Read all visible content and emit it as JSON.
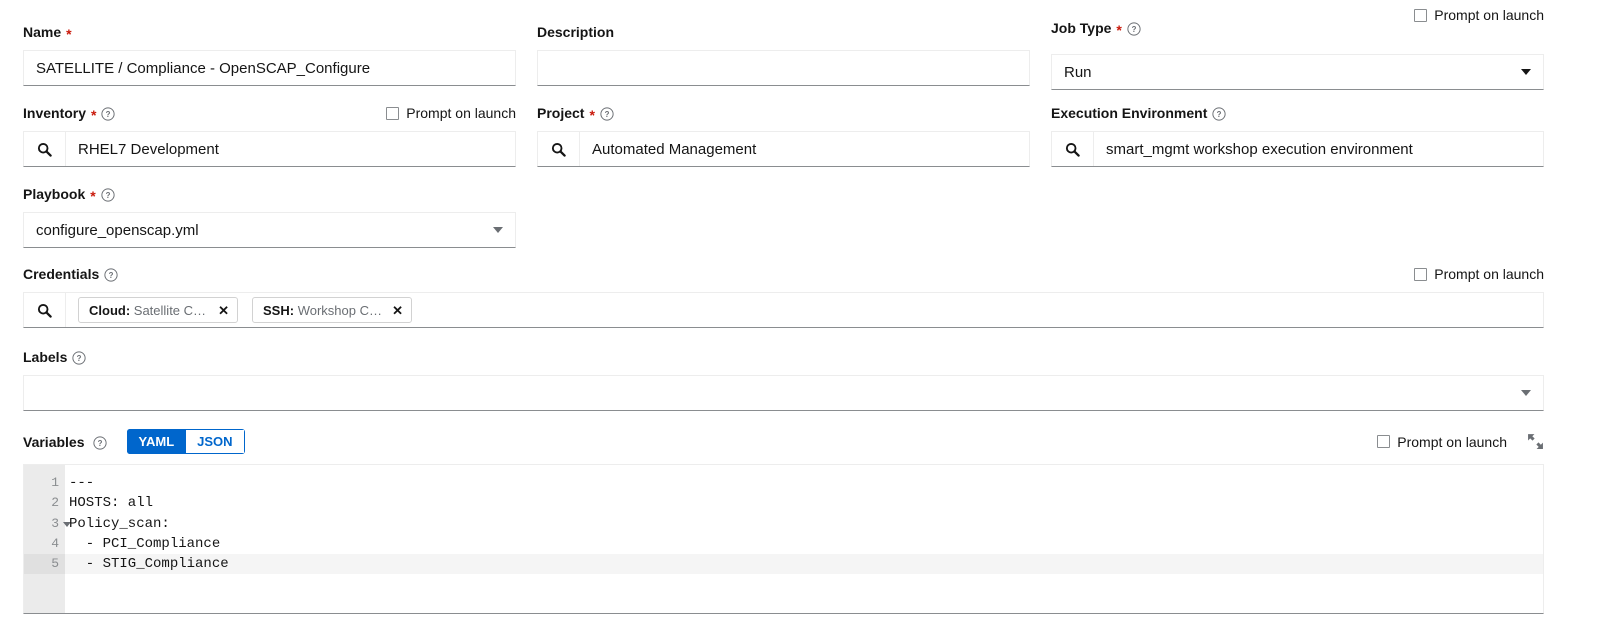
{
  "fields": {
    "name": {
      "label": "Name",
      "required": true,
      "value": "SATELLITE / Compliance - OpenSCAP_Configure"
    },
    "description": {
      "label": "Description",
      "required": false,
      "value": ""
    },
    "job_type": {
      "label": "Job Type",
      "required": true,
      "value": "Run",
      "prompt_on_launch": "Prompt on launch",
      "checked": false
    },
    "inventory": {
      "label": "Inventory",
      "required": true,
      "value": "RHEL7 Development",
      "prompt_on_launch": "Prompt on launch",
      "checked": false,
      "search_icon": "search-icon"
    },
    "project": {
      "label": "Project",
      "required": true,
      "value": "Automated Management",
      "search_icon": "search-icon"
    },
    "execution_environment": {
      "label": "Execution Environment",
      "required": false,
      "value": "smart_mgmt workshop execution environment",
      "search_icon": "search-icon"
    },
    "playbook": {
      "label": "Playbook",
      "required": true,
      "value": "configure_openscap.yml"
    },
    "credentials": {
      "label": "Credentials",
      "prompt_on_launch": "Prompt on launch",
      "checked": false,
      "search_icon": "search-icon",
      "chips": [
        {
          "type": "Cloud:",
          "name": "Satellite Crede...",
          "remove": "✕"
        },
        {
          "type": "SSH:",
          "name": "Workshop Cred...",
          "remove": "✕"
        }
      ]
    },
    "labels": {
      "label": "Labels",
      "value": ""
    },
    "variables": {
      "label": "Variables",
      "prompt_on_launch": "Prompt on launch",
      "checked": false,
      "format_yaml": "YAML",
      "format_json": "JSON",
      "active_format": "YAML",
      "expand_icon": "expand-icon",
      "lines": [
        {
          "num": "1",
          "text": "---",
          "fold": false,
          "highlight": false
        },
        {
          "num": "2",
          "text": "HOSTS: all",
          "fold": false,
          "highlight": false
        },
        {
          "num": "3",
          "text": "Policy_scan:",
          "fold": true,
          "highlight": false
        },
        {
          "num": "4",
          "text": "  - PCI_Compliance",
          "fold": false,
          "highlight": false
        },
        {
          "num": "5",
          "text": "  - STIG_Compliance",
          "fold": false,
          "highlight": true
        }
      ]
    }
  },
  "colors": {
    "accent": "#0066cc",
    "required": "#c9190b",
    "border": "#8a8d90"
  }
}
